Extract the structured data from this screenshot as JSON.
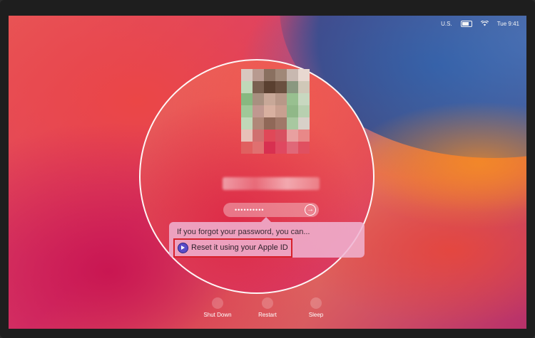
{
  "menubar": {
    "input_source": "U.S.",
    "clock": "Tue 9:41",
    "wifi_icon": "wifi-icon",
    "battery_icon": "battery-icon"
  },
  "login": {
    "password_mask": "••••••••••",
    "submit_icon": "arrow-right-circle-icon"
  },
  "hint": {
    "text": "If you forgot your password, you can...",
    "reset_label": "Reset it using your Apple ID",
    "reset_icon": "play-circle-icon"
  },
  "actions": {
    "shutdown": "Shut Down",
    "restart": "Restart",
    "sleep": "Sleep"
  },
  "colors": {
    "highlight": "#d8202a",
    "reset_icon": "#5a4cc8"
  }
}
